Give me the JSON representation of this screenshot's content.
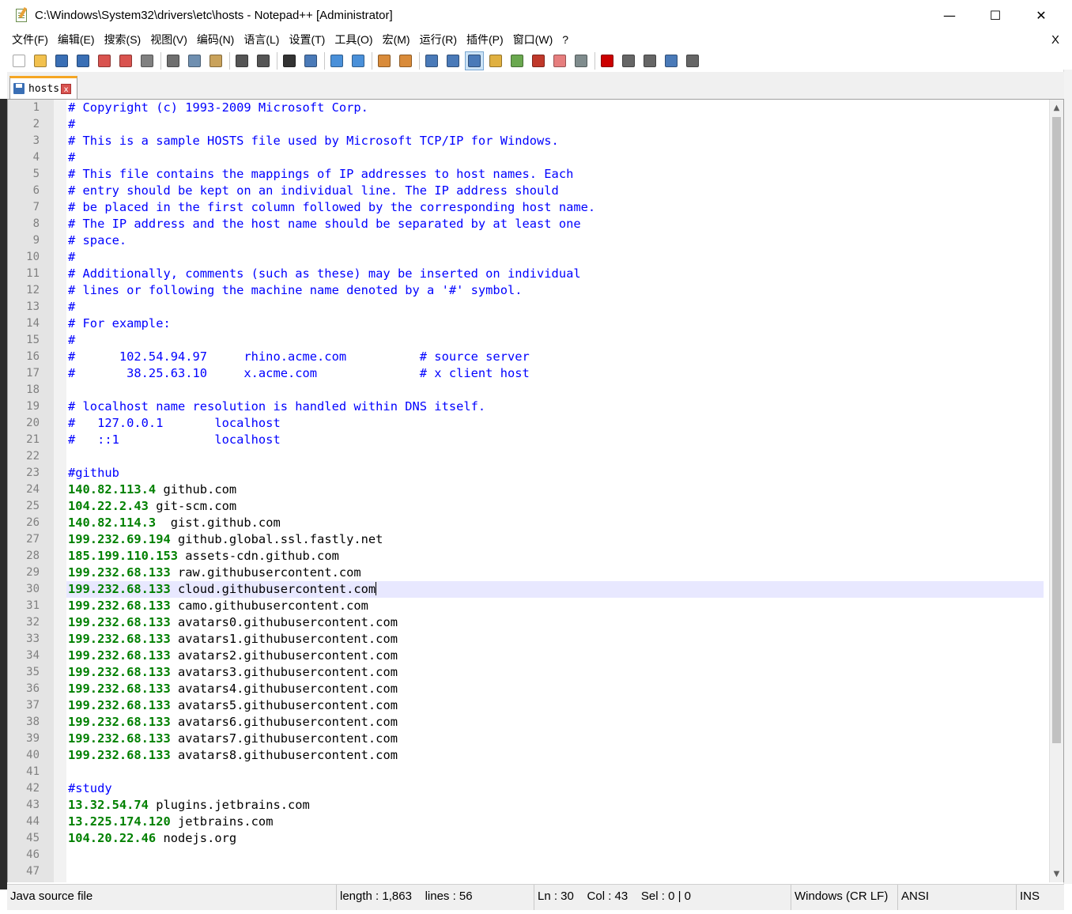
{
  "window": {
    "title": "C:\\Windows\\System32\\drivers\\etc\\hosts - Notepad++ [Administrator]",
    "minimize": "—",
    "maximize": "☐",
    "close": "✕"
  },
  "menu": {
    "items": [
      "文件(F)",
      "编辑(E)",
      "搜索(S)",
      "视图(V)",
      "编码(N)",
      "语言(L)",
      "设置(T)",
      "工具(O)",
      "宏(M)",
      "运行(R)",
      "插件(P)",
      "窗口(W)",
      "?"
    ],
    "close_doc": "X"
  },
  "toolbar": {
    "buttons": [
      {
        "name": "new-file-icon",
        "color": "#ffffff"
      },
      {
        "name": "open-file-icon",
        "color": "#f2c14e"
      },
      {
        "name": "save-icon",
        "color": "#3a6fb5"
      },
      {
        "name": "save-all-icon",
        "color": "#3a6fb5"
      },
      {
        "name": "close-icon",
        "color": "#d9534f"
      },
      {
        "name": "close-all-icon",
        "color": "#d9534f"
      },
      {
        "name": "print-icon",
        "color": "#808080"
      },
      {
        "sep": true
      },
      {
        "name": "cut-icon",
        "color": "#6f6f6f"
      },
      {
        "name": "copy-icon",
        "color": "#6f8fb0"
      },
      {
        "name": "paste-icon",
        "color": "#c9a25b"
      },
      {
        "sep": true
      },
      {
        "name": "undo-icon",
        "color": "#555555"
      },
      {
        "name": "redo-icon",
        "color": "#555555"
      },
      {
        "sep": true
      },
      {
        "name": "find-icon",
        "color": "#333333"
      },
      {
        "name": "replace-icon",
        "color": "#4a7ab8"
      },
      {
        "sep": true
      },
      {
        "name": "zoom-in-icon",
        "color": "#4a90d9"
      },
      {
        "name": "zoom-out-icon",
        "color": "#4a90d9"
      },
      {
        "sep": true
      },
      {
        "name": "sync-vertical-icon",
        "color": "#d98b3a"
      },
      {
        "name": "sync-horizontal-icon",
        "color": "#d98b3a"
      },
      {
        "sep": true
      },
      {
        "name": "word-wrap-icon",
        "color": "#4a7ab8"
      },
      {
        "name": "show-all-chars-icon",
        "color": "#4a7ab8"
      },
      {
        "name": "indent-guide-icon",
        "color": "#4a7ab8",
        "active": true
      },
      {
        "name": "define-language-icon",
        "color": "#e0b040"
      },
      {
        "name": "document-map-icon",
        "color": "#6aa84f"
      },
      {
        "name": "function-list-icon",
        "color": "#c0392b"
      },
      {
        "name": "folder-workspace-icon",
        "color": "#e67e7e"
      },
      {
        "name": "monitoring-icon",
        "color": "#7f8c8d"
      },
      {
        "sep": true
      },
      {
        "name": "macro-record-icon",
        "color": "#cc0000"
      },
      {
        "name": "macro-stop-icon",
        "color": "#666666"
      },
      {
        "name": "macro-play-icon",
        "color": "#666666"
      },
      {
        "name": "macro-run-multiple-icon",
        "color": "#4a7ab8"
      },
      {
        "name": "macro-save-icon",
        "color": "#666666"
      }
    ]
  },
  "tab": {
    "label": "hosts",
    "close": "x"
  },
  "editor": {
    "current_line": 30,
    "lines": [
      {
        "n": "1",
        "parts": [
          {
            "t": "# Copyright (c) 1993-2009 Microsoft Corp.",
            "c": "cmt"
          }
        ]
      },
      {
        "n": "2",
        "parts": [
          {
            "t": "#",
            "c": "cmt"
          }
        ]
      },
      {
        "n": "3",
        "parts": [
          {
            "t": "# This is a sample HOSTS file used by Microsoft TCP/IP for Windows.",
            "c": "cmt"
          }
        ]
      },
      {
        "n": "4",
        "parts": [
          {
            "t": "#",
            "c": "cmt"
          }
        ]
      },
      {
        "n": "5",
        "parts": [
          {
            "t": "# This file contains the mappings of IP addresses to host names. Each",
            "c": "cmt"
          }
        ]
      },
      {
        "n": "6",
        "parts": [
          {
            "t": "# entry should be kept on an individual line. The IP address should",
            "c": "cmt"
          }
        ]
      },
      {
        "n": "7",
        "parts": [
          {
            "t": "# be placed in the first column followed by the corresponding host name.",
            "c": "cmt"
          }
        ]
      },
      {
        "n": "8",
        "parts": [
          {
            "t": "# The IP address and the host name should be separated by at least one",
            "c": "cmt"
          }
        ]
      },
      {
        "n": "9",
        "parts": [
          {
            "t": "# space.",
            "c": "cmt"
          }
        ]
      },
      {
        "n": "10",
        "parts": [
          {
            "t": "#",
            "c": "cmt"
          }
        ]
      },
      {
        "n": "11",
        "parts": [
          {
            "t": "# Additionally, comments (such as these) may be inserted on individual",
            "c": "cmt"
          }
        ]
      },
      {
        "n": "12",
        "parts": [
          {
            "t": "# lines or following the machine name denoted by a '#' symbol.",
            "c": "cmt"
          }
        ]
      },
      {
        "n": "13",
        "parts": [
          {
            "t": "#",
            "c": "cmt"
          }
        ]
      },
      {
        "n": "14",
        "parts": [
          {
            "t": "# For example:",
            "c": "cmt"
          }
        ]
      },
      {
        "n": "15",
        "parts": [
          {
            "t": "#",
            "c": "cmt"
          }
        ]
      },
      {
        "n": "16",
        "parts": [
          {
            "t": "#      102.54.94.97     rhino.acme.com          # source server",
            "c": "cmt"
          }
        ]
      },
      {
        "n": "17",
        "parts": [
          {
            "t": "#       38.25.63.10     x.acme.com              # x client host",
            "c": "cmt"
          }
        ]
      },
      {
        "n": "18",
        "parts": []
      },
      {
        "n": "19",
        "parts": [
          {
            "t": "# localhost name resolution is handled within DNS itself.",
            "c": "cmt"
          }
        ]
      },
      {
        "n": "20",
        "parts": [
          {
            "t": "#   127.0.0.1       localhost",
            "c": "cmt"
          }
        ]
      },
      {
        "n": "21",
        "parts": [
          {
            "t": "#   ::1             localhost",
            "c": "cmt"
          }
        ]
      },
      {
        "n": "22",
        "parts": []
      },
      {
        "n": "23",
        "parts": [
          {
            "t": "#github",
            "c": "cmt"
          }
        ]
      },
      {
        "n": "24",
        "parts": [
          {
            "t": "140.82.113.4",
            "c": "ip"
          },
          {
            "t": " github.com",
            "c": "host"
          }
        ]
      },
      {
        "n": "25",
        "parts": [
          {
            "t": "104.22.2.43",
            "c": "ip"
          },
          {
            "t": " git-scm.com",
            "c": "host"
          }
        ]
      },
      {
        "n": "26",
        "parts": [
          {
            "t": "140.82.114.3",
            "c": "ip"
          },
          {
            "t": "  gist.github.com",
            "c": "host"
          }
        ]
      },
      {
        "n": "27",
        "parts": [
          {
            "t": "199.232.69.194",
            "c": "ip"
          },
          {
            "t": " github.global.ssl.fastly.net",
            "c": "host"
          }
        ]
      },
      {
        "n": "28",
        "parts": [
          {
            "t": "185.199.110.153",
            "c": "ip"
          },
          {
            "t": " assets-cdn.github.com",
            "c": "host"
          }
        ]
      },
      {
        "n": "29",
        "parts": [
          {
            "t": "199.232.68.133",
            "c": "ip"
          },
          {
            "t": " raw.githubusercontent.com",
            "c": "host"
          }
        ]
      },
      {
        "n": "30",
        "parts": [
          {
            "t": "199.232.68.133",
            "c": "ip"
          },
          {
            "t": " cloud.githubusercontent.com",
            "c": "host"
          }
        ]
      },
      {
        "n": "31",
        "parts": [
          {
            "t": "199.232.68.133",
            "c": "ip"
          },
          {
            "t": " camo.githubusercontent.com",
            "c": "host"
          }
        ]
      },
      {
        "n": "32",
        "parts": [
          {
            "t": "199.232.68.133",
            "c": "ip"
          },
          {
            "t": " avatars0.githubusercontent.com",
            "c": "host"
          }
        ]
      },
      {
        "n": "33",
        "parts": [
          {
            "t": "199.232.68.133",
            "c": "ip"
          },
          {
            "t": " avatars1.githubusercontent.com",
            "c": "host"
          }
        ]
      },
      {
        "n": "34",
        "parts": [
          {
            "t": "199.232.68.133",
            "c": "ip"
          },
          {
            "t": " avatars2.githubusercontent.com",
            "c": "host"
          }
        ]
      },
      {
        "n": "35",
        "parts": [
          {
            "t": "199.232.68.133",
            "c": "ip"
          },
          {
            "t": " avatars3.githubusercontent.com",
            "c": "host"
          }
        ]
      },
      {
        "n": "36",
        "parts": [
          {
            "t": "199.232.68.133",
            "c": "ip"
          },
          {
            "t": " avatars4.githubusercontent.com",
            "c": "host"
          }
        ]
      },
      {
        "n": "37",
        "parts": [
          {
            "t": "199.232.68.133",
            "c": "ip"
          },
          {
            "t": " avatars5.githubusercontent.com",
            "c": "host"
          }
        ]
      },
      {
        "n": "38",
        "parts": [
          {
            "t": "199.232.68.133",
            "c": "ip"
          },
          {
            "t": " avatars6.githubusercontent.com",
            "c": "host"
          }
        ]
      },
      {
        "n": "39",
        "parts": [
          {
            "t": "199.232.68.133",
            "c": "ip"
          },
          {
            "t": " avatars7.githubusercontent.com",
            "c": "host"
          }
        ]
      },
      {
        "n": "40",
        "parts": [
          {
            "t": "199.232.68.133",
            "c": "ip"
          },
          {
            "t": " avatars8.githubusercontent.com",
            "c": "host"
          }
        ]
      },
      {
        "n": "41",
        "parts": []
      },
      {
        "n": "42",
        "parts": [
          {
            "t": "#study",
            "c": "cmt"
          }
        ]
      },
      {
        "n": "43",
        "parts": [
          {
            "t": "13.32.54.74",
            "c": "ip"
          },
          {
            "t": " plugins.jetbrains.com",
            "c": "host"
          }
        ]
      },
      {
        "n": "44",
        "parts": [
          {
            "t": "13.225.174.120",
            "c": "ip"
          },
          {
            "t": " jetbrains.com",
            "c": "host"
          }
        ]
      },
      {
        "n": "45",
        "parts": [
          {
            "t": "104.20.22.46",
            "c": "ip"
          },
          {
            "t": " nodejs.org",
            "c": "host"
          }
        ]
      },
      {
        "n": "46",
        "parts": []
      },
      {
        "n": "47",
        "parts": []
      }
    ]
  },
  "scrollbar": {
    "up": "▲",
    "down": "▼"
  },
  "status": {
    "file_type": "Java source file",
    "length": "length : 1,863    lines : 56",
    "position": "Ln : 30    Col : 43    Sel : 0 | 0",
    "eol": "Windows (CR LF)",
    "encoding": "ANSI",
    "mode": "INS"
  },
  "colors": {
    "comment": "#0000ff",
    "ip": "#008000",
    "current_line": "#e8e8ff",
    "tab_accent": "#f5a623"
  }
}
